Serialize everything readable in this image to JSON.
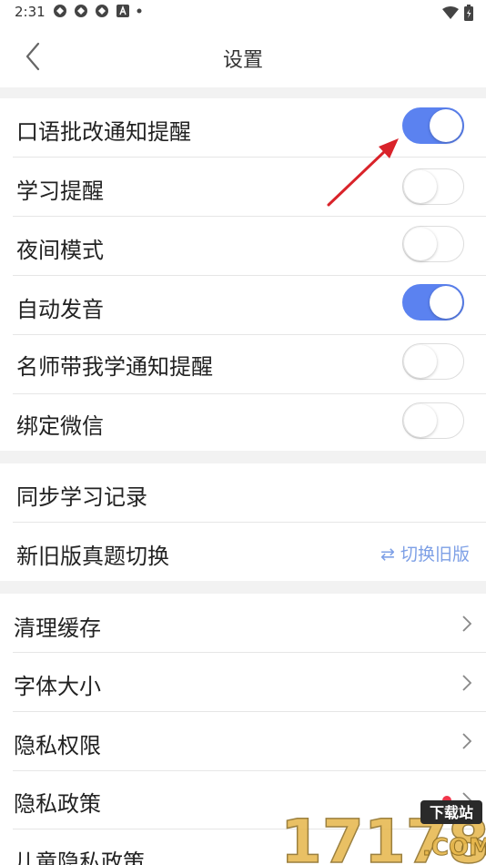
{
  "status_bar": {
    "time": "2:31"
  },
  "header": {
    "title": "设置"
  },
  "toggles": [
    {
      "label": "口语批改通知提醒",
      "on": true
    },
    {
      "label": "学习提醒",
      "on": false
    },
    {
      "label": "夜间模式",
      "on": false
    },
    {
      "label": "自动发音",
      "on": true
    },
    {
      "label": "名师带我学通知提醒",
      "on": false
    },
    {
      "label": "绑定微信",
      "on": false
    }
  ],
  "section2": {
    "sync_label": "同步学习记录",
    "version_label": "新旧版真题切换",
    "version_action": "⇄ 切换旧版"
  },
  "section3": {
    "items": [
      {
        "label": "清理缓存"
      },
      {
        "label": "字体大小"
      },
      {
        "label": "隐私权限"
      },
      {
        "label": "隐私政策"
      },
      {
        "label": "儿童隐私政策"
      }
    ]
  },
  "colors": {
    "toggle_on": "#5b82f0",
    "link": "#7ea0e6",
    "dot": "#f0364b",
    "arrow": "#d9232a"
  },
  "watermark": {
    "text": "17178",
    "badge": "下载站",
    "domain": ".COM"
  }
}
